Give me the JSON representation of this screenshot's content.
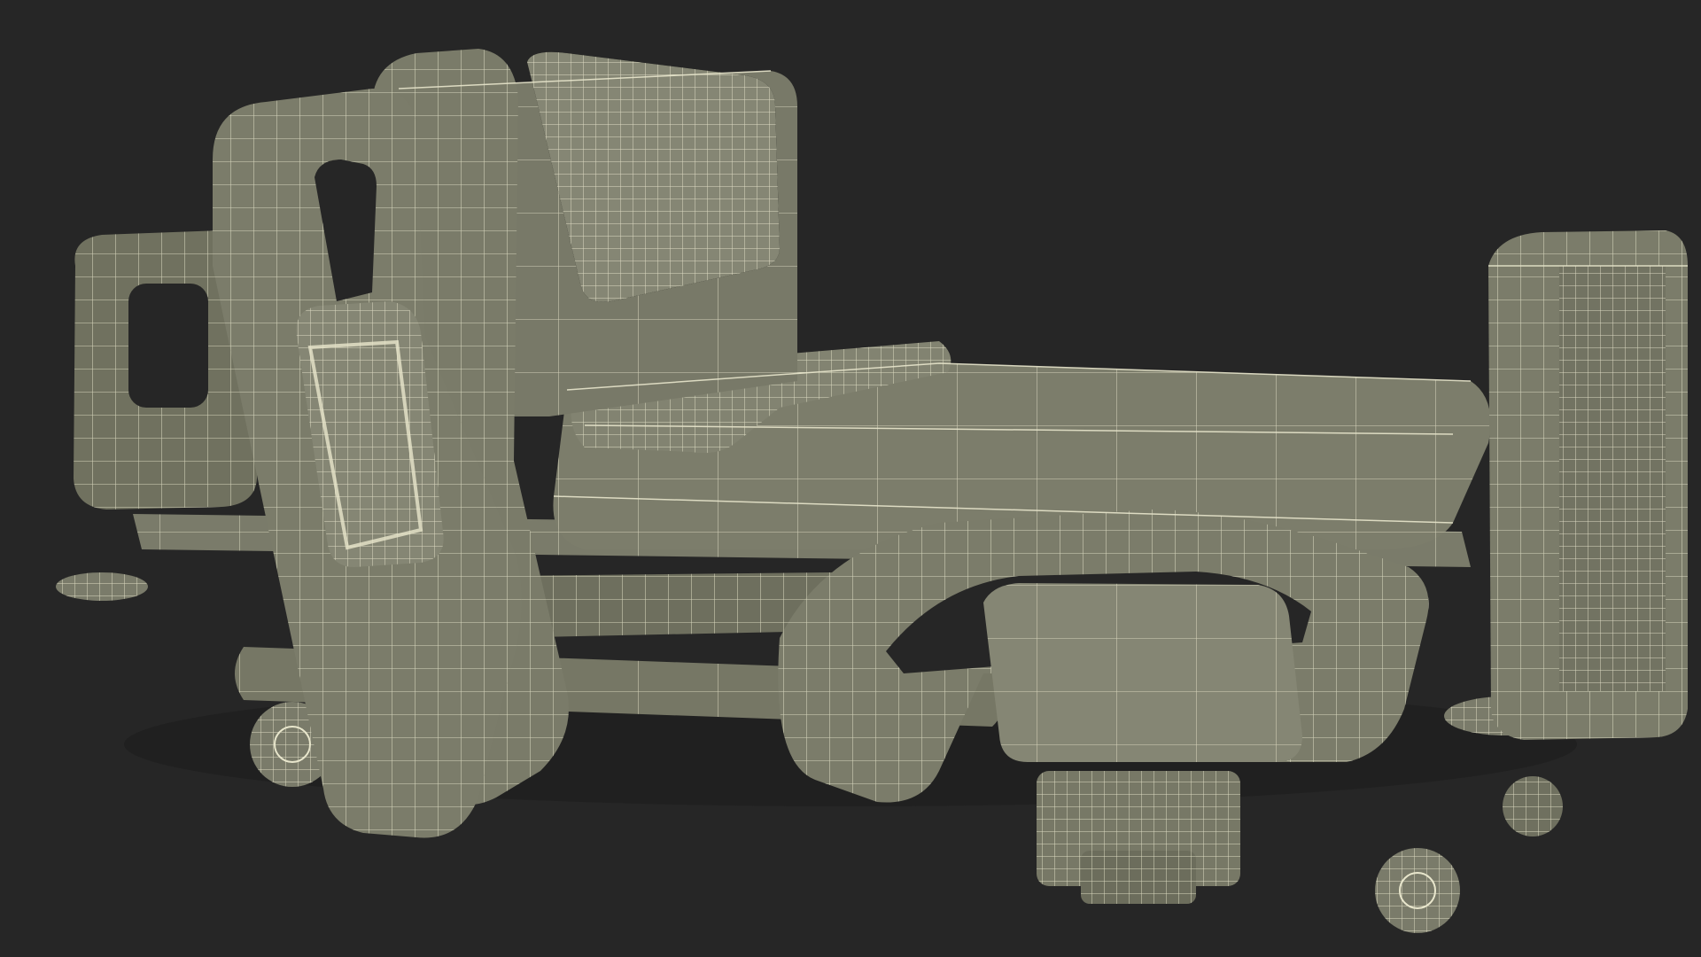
{
  "viewport": {
    "background_color": "#262626"
  },
  "render": {
    "style": "wireframe-over-shaded",
    "surface_color": "#7a7b6a",
    "surface_shadow_color": "#5e6052",
    "surface_highlight_color": "#8e8f7c",
    "wire_color": "#e8e6cc"
  },
  "subject": {
    "icon": "hospital-bed-icon",
    "parts": [
      "headboard",
      "pillow",
      "backrest",
      "mattress",
      "blanket-fold",
      "side-rail",
      "footboard",
      "frame",
      "caster-wheels",
      "pedal"
    ]
  }
}
